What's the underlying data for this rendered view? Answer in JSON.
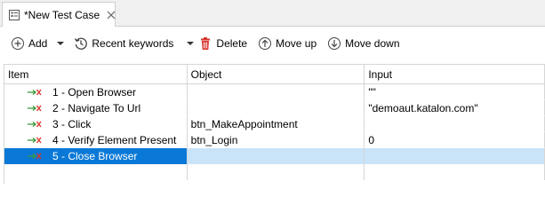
{
  "tab": {
    "title": "*New Test Case"
  },
  "toolbar": {
    "add_label": "Add",
    "recent_label": "Recent keywords",
    "delete_label": "Delete",
    "move_up_label": "Move up",
    "move_down_label": "Move down"
  },
  "table": {
    "columns": [
      "Item",
      "Object",
      "Input"
    ],
    "rows": [
      {
        "item": "1 - Open Browser",
        "object": "",
        "input": "\"\""
      },
      {
        "item": "2 - Navigate To Url",
        "object": "",
        "input": "\"demoaut.katalon.com\""
      },
      {
        "item": "3 - Click",
        "object": "btn_MakeAppointment",
        "input": ""
      },
      {
        "item": "4 - Verify Element Present",
        "object": "btn_Login",
        "input": "0"
      },
      {
        "item": "5 - Close Browser",
        "object": "",
        "input": ""
      }
    ],
    "selected_row": 4
  },
  "colors": {
    "selection_item": "#0a78d7",
    "selection_row": "#c9e3f9",
    "keyword_icon_green": "#3a9a3a",
    "keyword_icon_red": "#d9342b",
    "delete_red": "#d9342b"
  },
  "icons": {
    "tab_icon": "test-case-icon",
    "tab_close": "close-icon",
    "add": "plus-circle-icon",
    "recent": "history-icon",
    "delete": "trash-icon",
    "move_up": "arrow-up-circle-icon",
    "move_down": "arrow-down-circle-icon",
    "keyword": "keyword-step-icon"
  }
}
